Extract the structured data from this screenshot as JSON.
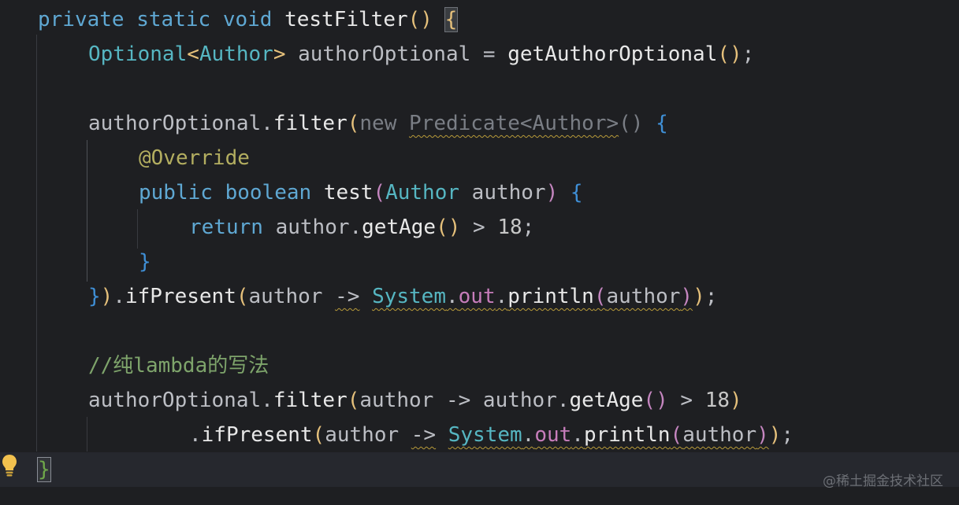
{
  "editor": {
    "lines": [
      {
        "tokens": [
          [
            "kw2",
            "private "
          ],
          [
            "kw2",
            "static "
          ],
          [
            "kw2",
            "void "
          ],
          [
            "method",
            "testFilter"
          ],
          [
            "paren",
            "()"
          ],
          [
            "plain",
            " "
          ],
          [
            "brace-yellow hl",
            "{"
          ]
        ]
      },
      {
        "tokens": [
          [
            "type",
            "Optional"
          ],
          [
            "brace-yellow",
            "<"
          ],
          [
            "type",
            "Author"
          ],
          [
            "brace-yellow",
            ">"
          ],
          [
            "plain",
            " "
          ],
          [
            "ident",
            "authorOptional"
          ],
          [
            "plain",
            " = "
          ],
          [
            "method",
            "getAuthorOptional"
          ],
          [
            "paren",
            "()"
          ],
          [
            "plain",
            ";"
          ]
        ]
      },
      {
        "tokens": []
      },
      {
        "tokens": [
          [
            "ident",
            "authorOptional"
          ],
          [
            "plain",
            "."
          ],
          [
            "method",
            "filter"
          ],
          [
            "paren",
            "("
          ],
          [
            "muted",
            "new "
          ],
          [
            "muted squiggle",
            "Predicate<Author>"
          ],
          [
            "muted",
            "() "
          ],
          [
            "brace-blue",
            "{"
          ]
        ]
      },
      {
        "tokens": [
          [
            "anno",
            "@Override"
          ]
        ]
      },
      {
        "tokens": [
          [
            "kw2",
            "public "
          ],
          [
            "kw2",
            "boolean "
          ],
          [
            "method",
            "test"
          ],
          [
            "paren2",
            "("
          ],
          [
            "type",
            "Author"
          ],
          [
            "plain",
            " author"
          ],
          [
            "paren2",
            ")"
          ],
          [
            "plain",
            " "
          ],
          [
            "brace-blue",
            "{"
          ]
        ]
      },
      {
        "tokens": [
          [
            "kw2",
            "return "
          ],
          [
            "plain",
            "author."
          ],
          [
            "method",
            "getAge"
          ],
          [
            "paren",
            "()"
          ],
          [
            "plain",
            " > "
          ],
          [
            "num",
            "18"
          ],
          [
            "plain",
            ";"
          ]
        ]
      },
      {
        "tokens": [
          [
            "brace-blue",
            "}"
          ]
        ]
      },
      {
        "tokens": [
          [
            "brace-blue",
            "}"
          ],
          [
            "paren",
            ")"
          ],
          [
            "plain",
            "."
          ],
          [
            "method",
            "ifPresent"
          ],
          [
            "paren",
            "("
          ],
          [
            "plain",
            "author "
          ],
          [
            "plain squiggle",
            "->"
          ],
          [
            "plain",
            " "
          ],
          [
            "type squiggle",
            "System"
          ],
          [
            "plain squiggle",
            "."
          ],
          [
            "field squiggle",
            "out"
          ],
          [
            "plain squiggle",
            "."
          ],
          [
            "method squiggle",
            "println"
          ],
          [
            "paren2 squiggle",
            "("
          ],
          [
            "plain squiggle",
            "author"
          ],
          [
            "paren2 squiggle",
            ")"
          ],
          [
            "paren",
            ")"
          ],
          [
            "plain",
            ";"
          ]
        ]
      },
      {
        "tokens": []
      },
      {
        "tokens": [
          [
            "comment",
            "//纯lambda的写法"
          ]
        ]
      },
      {
        "tokens": [
          [
            "ident",
            "authorOptional"
          ],
          [
            "plain",
            "."
          ],
          [
            "method",
            "filter"
          ],
          [
            "paren",
            "("
          ],
          [
            "plain",
            "author -> author."
          ],
          [
            "method",
            "getAge"
          ],
          [
            "paren2",
            "()"
          ],
          [
            "plain",
            " > "
          ],
          [
            "num",
            "18"
          ],
          [
            "paren",
            ")"
          ]
        ]
      },
      {
        "tokens": [
          [
            "plain",
            "."
          ],
          [
            "method",
            "ifPresent"
          ],
          [
            "paren",
            "("
          ],
          [
            "plain",
            "author "
          ],
          [
            "plain squiggle",
            "->"
          ],
          [
            "plain",
            " "
          ],
          [
            "type squiggle",
            "System"
          ],
          [
            "plain squiggle",
            "."
          ],
          [
            "field squiggle",
            "out"
          ],
          [
            "plain squiggle",
            "."
          ],
          [
            "method squiggle",
            "println"
          ],
          [
            "paren2 squiggle",
            "("
          ],
          [
            "plain squiggle",
            "author"
          ],
          [
            "paren2 squiggle",
            ")"
          ],
          [
            "paren",
            ")"
          ],
          [
            "plain",
            ";"
          ]
        ]
      },
      {
        "tokens": [
          [
            "caret-brace",
            "}"
          ]
        ]
      }
    ]
  },
  "watermark": "@稀土掘金技术社区",
  "icons": {
    "intention": "lightbulb-icon"
  },
  "colors": {
    "background": "#1e1f22",
    "keyword": "#5fa8d3",
    "type": "#56b6c2",
    "comment": "#7ea46b"
  }
}
